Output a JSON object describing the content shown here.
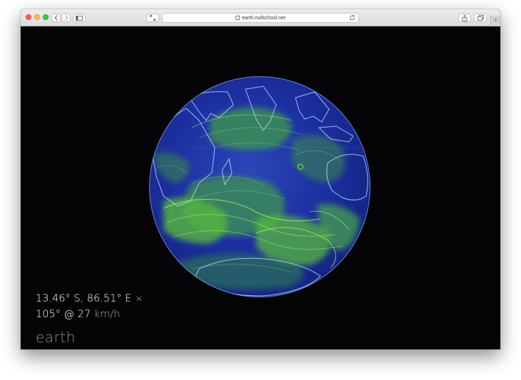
{
  "browser": {
    "url": "earth.nullschool.net",
    "new_tab_symbol": "+"
  },
  "location": {
    "coordinates": "13.46° S, 86.51° E",
    "close_symbol": "×",
    "wind_direction_speed": "105° @ 27",
    "wind_unit": "km/h"
  },
  "brand": {
    "name": "earth"
  },
  "icons": {
    "back": "chevron-left-icon",
    "forward": "chevron-right-icon",
    "sidebar": "sidebar-icon",
    "resize": "fullscreen-icon",
    "reload": "reload-icon",
    "share": "share-icon",
    "tabs": "tabs-overview-icon",
    "lock": "lock-icon",
    "marker": "location-marker-icon"
  },
  "colors": {
    "ocean_background": "#040406",
    "globe_base": "#1c2fa0",
    "wind_flow": "#6ede4a",
    "coastline": "#b8d4ff",
    "marker": "#51e24f"
  }
}
